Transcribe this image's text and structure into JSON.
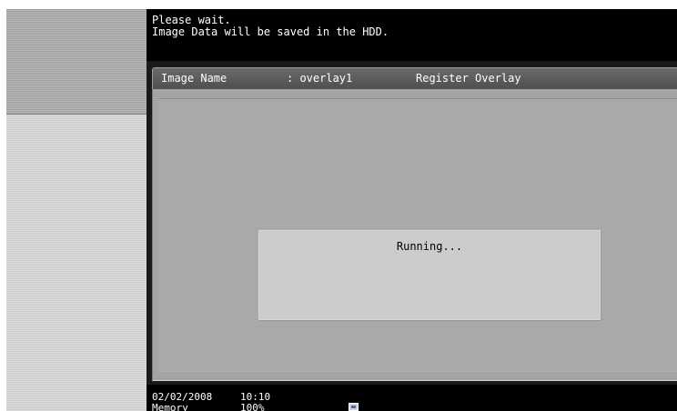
{
  "message": {
    "line1": "Please wait.",
    "line2": "Image Data will be saved in the HDD."
  },
  "header": {
    "image_name_label": "Image Name",
    "image_name_value": ": overlay1",
    "action_label": "Register Overlay"
  },
  "dialog": {
    "status_text": "Running..."
  },
  "status_bar": {
    "date": "02/02/2008",
    "time": "10:10",
    "memory_label": "Memory",
    "memory_value": "100%",
    "icon": "storage-icon"
  },
  "colors": {
    "band": "#000000",
    "header": "#5a5a5a",
    "content": "#a8a8a8",
    "dialog": "#cccccc"
  }
}
